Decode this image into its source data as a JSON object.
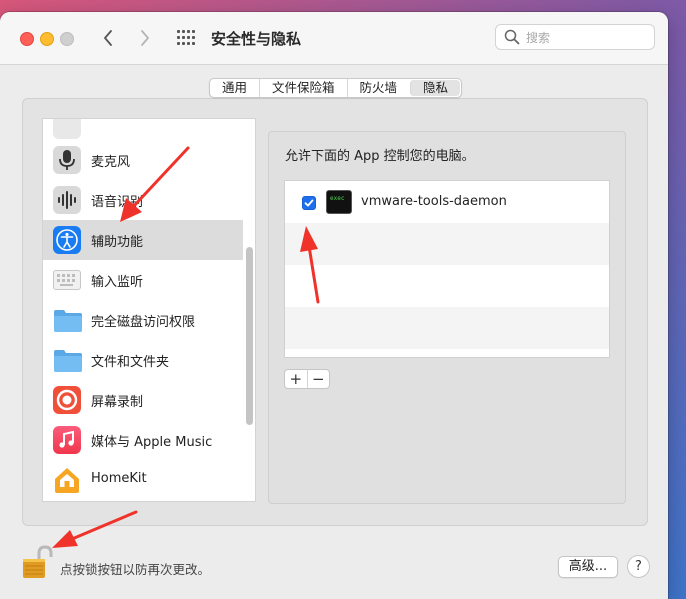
{
  "window": {
    "title": "安全性与隐私"
  },
  "search": {
    "placeholder": "搜索"
  },
  "tabs": [
    {
      "label": "通用",
      "active": false
    },
    {
      "label": "文件保险箱",
      "active": false
    },
    {
      "label": "防火墙",
      "active": false
    },
    {
      "label": "隐私",
      "active": true
    }
  ],
  "sidebar": {
    "items": [
      {
        "label": "麦克风",
        "icon": "microphone-icon"
      },
      {
        "label": "语音识别",
        "icon": "speech-recognition-icon"
      },
      {
        "label": "辅助功能",
        "icon": "accessibility-icon",
        "selected": true
      },
      {
        "label": "输入监听",
        "icon": "keyboard-icon"
      },
      {
        "label": "完全磁盘访问权限",
        "icon": "folder-icon"
      },
      {
        "label": "文件和文件夹",
        "icon": "folder-icon"
      },
      {
        "label": "屏幕录制",
        "icon": "screen-recording-icon"
      },
      {
        "label": "媒体与 Apple Music",
        "icon": "music-icon"
      },
      {
        "label": "HomeKit",
        "icon": "home-icon"
      }
    ]
  },
  "panel": {
    "title": "允许下面的 App 控制您的电脑。",
    "apps": [
      {
        "label": "vmware-tools-daemon",
        "checked": true,
        "icon": "terminal-icon"
      }
    ],
    "add_label": "+",
    "remove_label": "−"
  },
  "footer": {
    "lock_text": "点按锁按钮以防再次更改。",
    "advanced_label": "高级...",
    "help_label": "?"
  },
  "colors": {
    "accent": "#1e6ff0",
    "annotation_arrow": "#f0332a"
  }
}
